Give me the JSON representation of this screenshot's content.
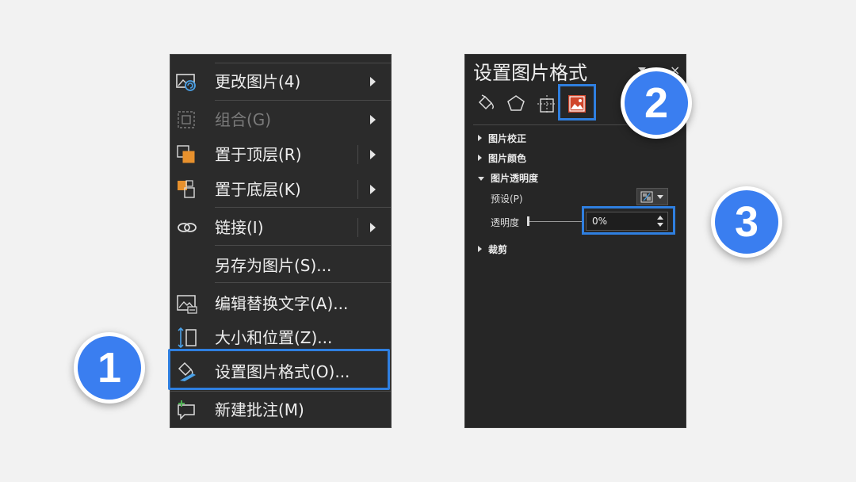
{
  "context_menu": {
    "items": [
      {
        "label": "更改图片(4)",
        "icon": "change-picture-icon",
        "submenu": true,
        "disabled": false
      },
      {
        "label": "组合(G)",
        "icon": "group-icon",
        "submenu": true,
        "disabled": true
      },
      {
        "label": "置于顶层(R)",
        "icon": "bring-to-front-icon",
        "submenu": true,
        "disabled": false
      },
      {
        "label": "置于底层(K)",
        "icon": "send-to-back-icon",
        "submenu": true,
        "disabled": false
      },
      {
        "label": "链接(I)",
        "icon": "link-icon",
        "submenu": true,
        "disabled": false
      },
      {
        "label": "另存为图片(S)...",
        "icon": "",
        "submenu": false,
        "disabled": false
      },
      {
        "label": "编辑替换文字(A)...",
        "icon": "alt-text-icon",
        "submenu": false,
        "disabled": false
      },
      {
        "label": "大小和位置(Z)...",
        "icon": "size-position-icon",
        "submenu": false,
        "disabled": false
      },
      {
        "label": "设置图片格式(O)...",
        "icon": "format-picture-icon",
        "submenu": false,
        "disabled": false,
        "highlighted": true
      },
      {
        "label": "新建批注(M)",
        "icon": "new-comment-icon",
        "submenu": false,
        "disabled": false
      }
    ]
  },
  "format_pane": {
    "title": "设置图片格式",
    "close": "×",
    "tabs": [
      {
        "icon": "fill-line-icon",
        "active": false
      },
      {
        "icon": "effects-pentagon-icon",
        "active": false
      },
      {
        "icon": "size-properties-icon",
        "active": false
      },
      {
        "icon": "picture-icon",
        "active": true
      }
    ],
    "sections": {
      "correction": "图片校正",
      "color": "图片颜色",
      "transparency": "图片透明度",
      "crop": "裁剪"
    },
    "preset_label": "预设(P)",
    "transparency_label": "透明度",
    "transparency_value": "0%",
    "transparency_slider_fraction": 0
  },
  "badges": [
    "1",
    "2",
    "3"
  ],
  "colors": {
    "highlight": "#2f7fe0",
    "badge": "#3a7ef0",
    "icon_orange": "#e8912d",
    "icon_blue": "#4aa0e6",
    "picture_tab_red": "#d0462c"
  }
}
